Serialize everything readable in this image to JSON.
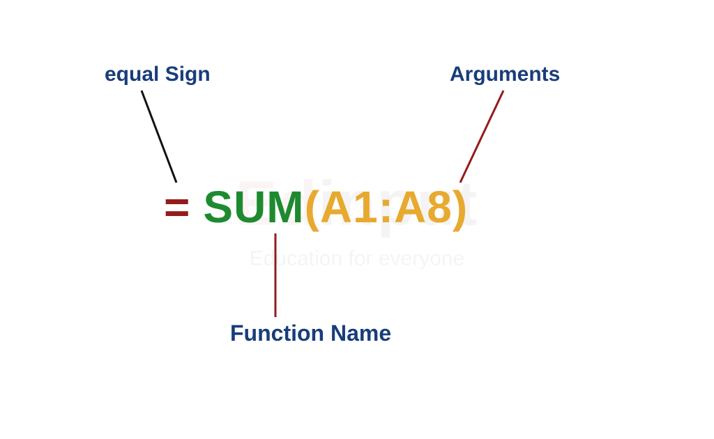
{
  "labels": {
    "equal": "equal Sign",
    "arguments": "Arguments",
    "function": "Function Name"
  },
  "formula": {
    "equal": "=",
    "name": "SUM",
    "args": "(A1:A8)"
  },
  "watermark": {
    "brand_prefix": "Ed",
    "brand_suffix": "input",
    "tagline": "Education for everyone"
  },
  "colors": {
    "label": "#193d7a",
    "equal": "#941b1b",
    "function": "#1e8a2f",
    "args": "#e8a92f",
    "connector_dark": "#111111",
    "connector_red": "#941b1b"
  }
}
